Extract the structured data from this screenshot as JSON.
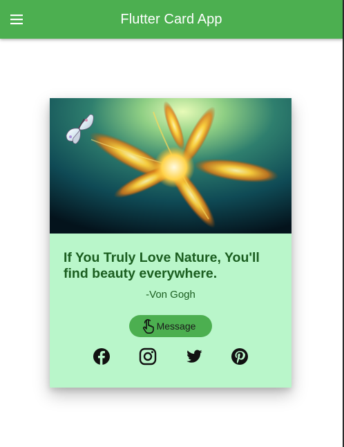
{
  "app_bar": {
    "title": "Flutter Card App",
    "color": "#4caf50",
    "menu_icon": "hamburger-menu-icon"
  },
  "card": {
    "background": "#b9f6ca",
    "image_description_icon": "butterfly-and-glowing-flower-image",
    "quote": "If You Truly Love Nature, You'll find beauty everywhere.",
    "author": "-Von Gogh",
    "message_button": {
      "label": "Message",
      "icon": "touch-hand-icon",
      "color": "#4caf50"
    },
    "social_links": [
      {
        "name": "facebook",
        "icon": "facebook-icon"
      },
      {
        "name": "instagram",
        "icon": "instagram-icon"
      },
      {
        "name": "twitter",
        "icon": "twitter-icon"
      },
      {
        "name": "pinterest",
        "icon": "pinterest-icon"
      }
    ]
  }
}
